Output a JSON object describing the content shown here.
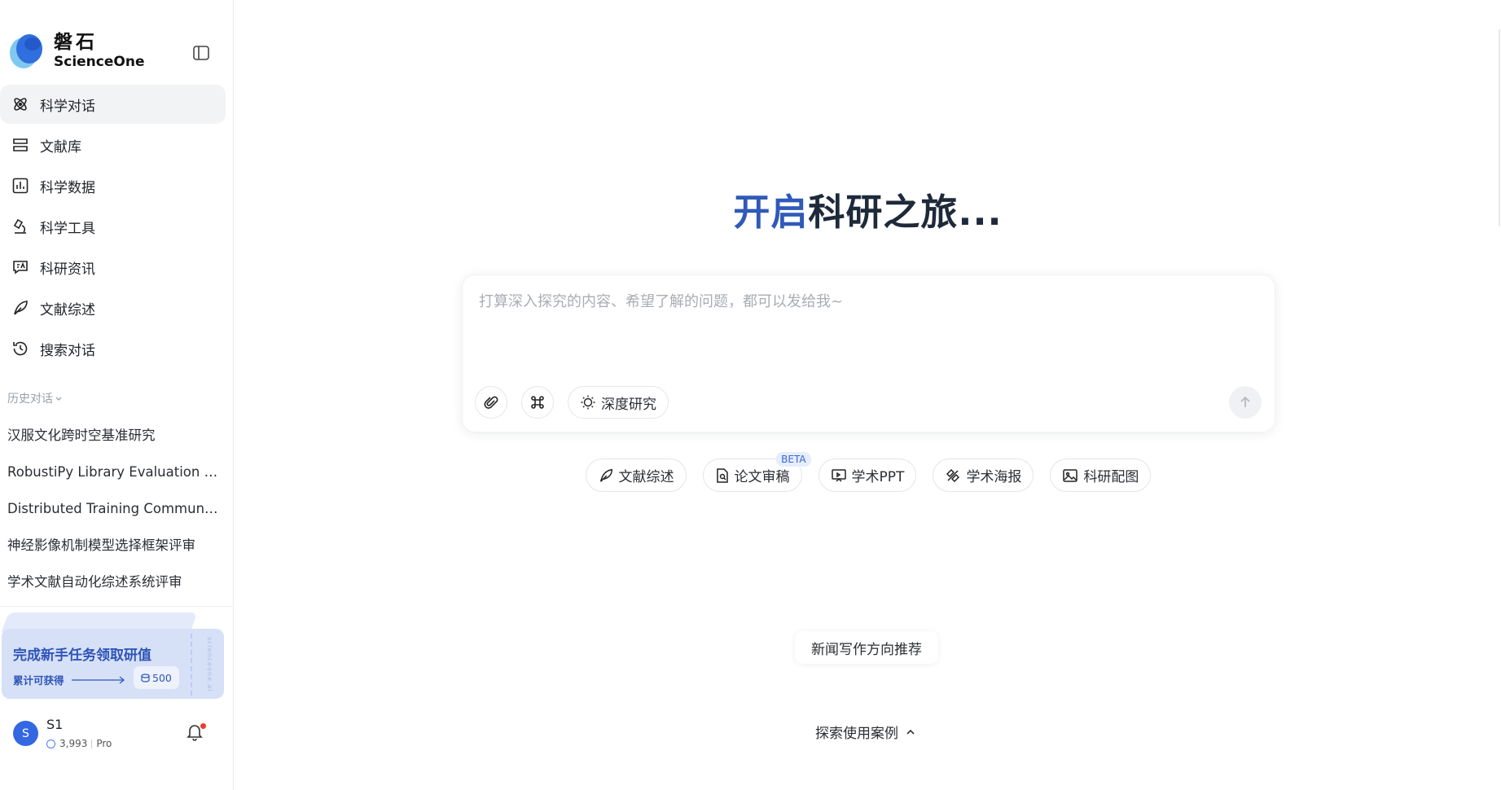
{
  "brand": {
    "name_cn": "磐石",
    "name_en": "ScienceOne",
    "accent": "#2f6fde"
  },
  "nav": {
    "items": [
      {
        "label": "科学对话",
        "icon": "atom-icon",
        "active": true
      },
      {
        "label": "文献库",
        "icon": "library-icon"
      },
      {
        "label": "科学数据",
        "icon": "chart-icon"
      },
      {
        "label": "科学工具",
        "icon": "microscope-icon"
      },
      {
        "label": "科研资讯",
        "icon": "news-icon"
      },
      {
        "label": "文献综述",
        "icon": "feather-icon"
      },
      {
        "label": "搜索对话",
        "icon": "history-icon"
      }
    ]
  },
  "history": {
    "title": "历史对话",
    "items": [
      "汉服文化跨时空基准研究",
      "RobustiPy Library Evaluation Re...",
      "Distributed Training Communic...",
      "神经影像机制模型选择框架评审",
      "学术文献自动化综述系统评审"
    ]
  },
  "promo": {
    "title": "完成新手任务领取研值",
    "subtitle": "累计可获得",
    "amount": "500",
    "vertical_text": "scienceone.ai"
  },
  "user": {
    "avatar_letter": "S",
    "name": "S1",
    "points": "3,993",
    "plan": "Pro"
  },
  "main": {
    "hero_accent": "开启",
    "hero_rest": "科研之旅...",
    "composer": {
      "placeholder": "打算深入探究的内容、希望了解的问题，都可以发给我~",
      "deep_research_label": "深度研究"
    },
    "tools": [
      {
        "label": "文献综述",
        "icon": "feather-icon"
      },
      {
        "label": "论文审稿",
        "icon": "document-search-icon",
        "badge": "BETA"
      },
      {
        "label": "学术PPT",
        "icon": "presentation-icon"
      },
      {
        "label": "学术海报",
        "icon": "poster-icon"
      },
      {
        "label": "科研配图",
        "icon": "image-icon"
      }
    ],
    "suggestion": "新闻写作方向推荐",
    "explore_label": "探索使用案例"
  }
}
